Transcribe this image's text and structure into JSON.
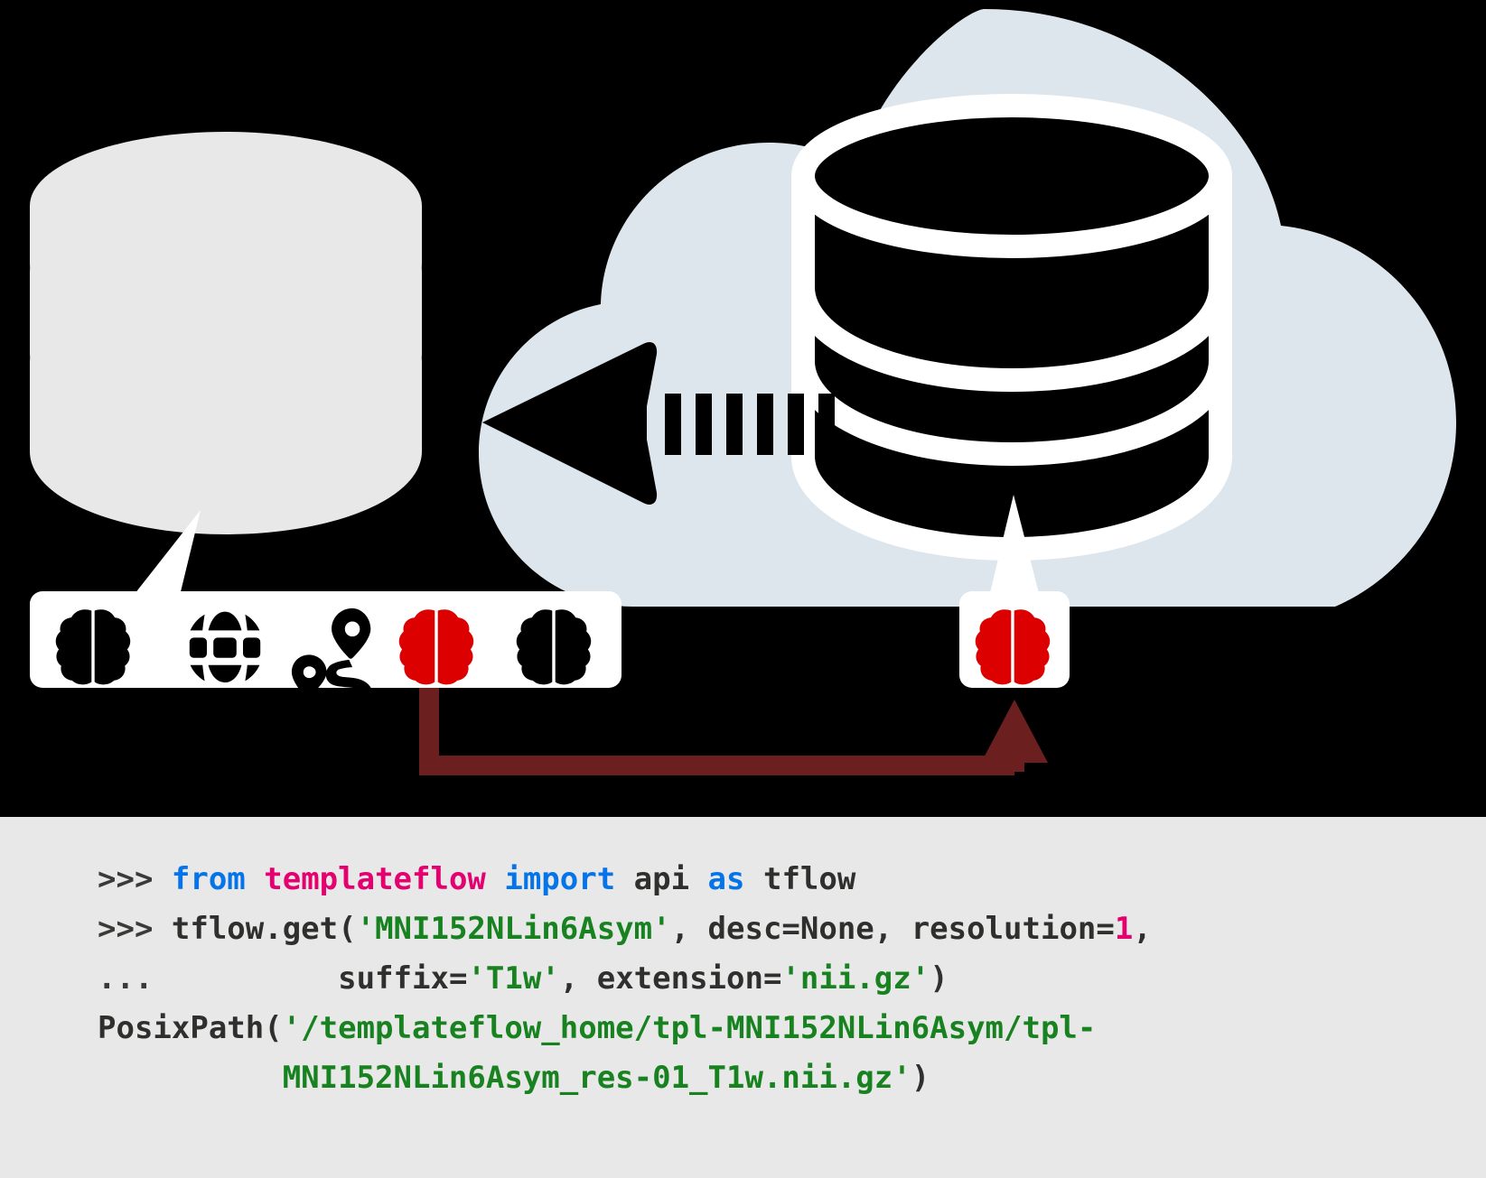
{
  "figure": {
    "background_color": "#000000",
    "console_background_color": "#e8e8e8"
  },
  "diagram": {
    "local_database": {
      "name": "local-template-cache-database",
      "color": "#e8e8e8",
      "layers": 3
    },
    "cloud": {
      "name": "templateflow-cloud-archive",
      "color": "#dde5ed"
    },
    "cloud_database": {
      "name": "remote-template-database",
      "color": "#000000",
      "outline_color": "#ffffff",
      "layers": 3
    },
    "download_arrow": {
      "name": "download-arrow",
      "direction": "left",
      "color": "#000000",
      "dash_count": 6
    },
    "connector": {
      "name": "fetch-connector",
      "color": "#6b1f1f",
      "direction": "up-right"
    },
    "local_icon_bar": {
      "name": "local-cached-templates-bar",
      "background_color": "#ffffff",
      "icons": [
        {
          "name": "brain-icon",
          "label": "brain",
          "color": "#000000"
        },
        {
          "name": "globe-icon",
          "label": "globe",
          "color": "#000000"
        },
        {
          "name": "route-icon",
          "label": "route",
          "color": "#000000"
        },
        {
          "name": "brain-icon-highlighted",
          "label": "brain",
          "color": "#dd0000"
        },
        {
          "name": "brain-icon",
          "label": "brain",
          "color": "#000000"
        }
      ]
    },
    "remote_icon_bar": {
      "name": "requested-template-badge",
      "background_color": "#ffffff",
      "icons": [
        {
          "name": "brain-icon-highlighted",
          "label": "brain",
          "color": "#dd0000"
        }
      ]
    }
  },
  "colors": {
    "prompt": "#3a3a38",
    "keyword": "#0474e8",
    "module": "#e4006f",
    "plain": "#2f2f2d",
    "string": "#17821f",
    "number": "#e4006f",
    "highlight_red": "#dd0000",
    "cloud_blue": "#dde5ed",
    "connector_dark_red": "#6b1f1f"
  },
  "console": {
    "name": "python-repl-transcript",
    "lines": [
      {
        "id": "line1",
        "tokens": [
          {
            "text": ">>> ",
            "style": "prompt"
          },
          {
            "text": "from ",
            "style": "kw"
          },
          {
            "text": "templateflow ",
            "style": "mod"
          },
          {
            "text": "import ",
            "style": "kw"
          },
          {
            "text": "api ",
            "style": "plain"
          },
          {
            "text": "as ",
            "style": "kw"
          },
          {
            "text": "tflow",
            "style": "plain"
          }
        ]
      },
      {
        "id": "line2",
        "tokens": [
          {
            "text": ">>> ",
            "style": "prompt"
          },
          {
            "text": "tflow.get(",
            "style": "plain"
          },
          {
            "text": "'MNI152NLin6Asym'",
            "style": "str"
          },
          {
            "text": ", desc=None, resolution=",
            "style": "plain"
          },
          {
            "text": "1",
            "style": "num"
          },
          {
            "text": ",",
            "style": "plain"
          }
        ]
      },
      {
        "id": "line3",
        "tokens": [
          {
            "text": "...",
            "style": "prompt"
          },
          {
            "text": "          suffix=",
            "style": "plain"
          },
          {
            "text": "'T1w'",
            "style": "str"
          },
          {
            "text": ", extension=",
            "style": "plain"
          },
          {
            "text": "'nii.gz'",
            "style": "str"
          },
          {
            "text": ")",
            "style": "plain"
          }
        ]
      },
      {
        "id": "line4",
        "tokens": [
          {
            "text": "PosixPath(",
            "style": "plain"
          },
          {
            "text": "'/templateflow_home/tpl-MNI152NLin6Asym/tpl-",
            "style": "str"
          }
        ]
      },
      {
        "id": "line5",
        "tokens": [
          {
            "text": "          ",
            "style": "plain"
          },
          {
            "text": "MNI152NLin6Asym_res-01_T1w.nii.gz'",
            "style": "str"
          },
          {
            "text": ")",
            "style": "plain"
          }
        ]
      }
    ]
  }
}
